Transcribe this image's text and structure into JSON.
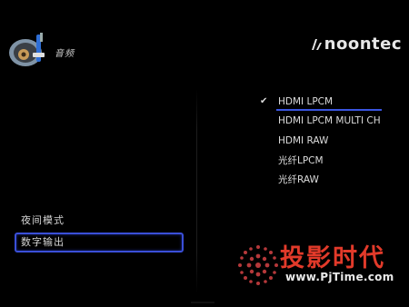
{
  "header": {
    "section_title": "音频",
    "brand": "noontec",
    "icon": "audio-settings-icon"
  },
  "left_menu": {
    "items": [
      {
        "label": "夜间模式",
        "selected": false
      },
      {
        "label": "数字输出",
        "selected": true
      }
    ]
  },
  "options": {
    "checkmark": "✔",
    "items": [
      {
        "label": "HDMI LPCM",
        "selected": true
      },
      {
        "label": "HDMI LPCM MULTI CH",
        "selected": false
      },
      {
        "label": "HDMI RAW",
        "selected": false
      },
      {
        "label": "光纤LPCM",
        "selected": false
      },
      {
        "label": "光纤RAW",
        "selected": false
      }
    ]
  },
  "watermark": {
    "text": "投影时代",
    "url": "www.PjTime.com"
  },
  "colors": {
    "accent": "#3a4fd8",
    "watermark_red": "#e23a2a",
    "background": "#000000"
  }
}
